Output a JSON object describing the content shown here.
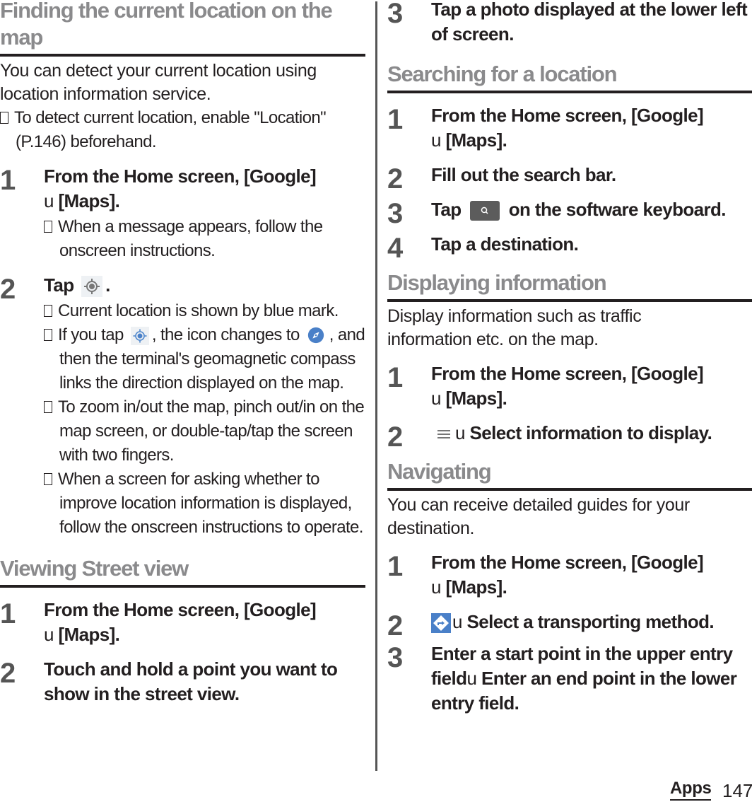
{
  "left_column": {
    "section1": {
      "title": "Finding the current location on the map",
      "intro": "You can detect your current location using location information service.",
      "notes": [
        "To detect current location, enable \"Location\" (P.146) beforehand."
      ],
      "steps": [
        {
          "number": "1",
          "text_a": "From the Home screen, [Google]",
          "arrow": "u",
          "text_b": "[Maps].",
          "notes": [
            "When a message appears, follow the onscreen instructions."
          ]
        },
        {
          "number": "2",
          "text_a": "Tap",
          "icon": "my-location-icon",
          "text_b": ".",
          "notes": [
            "Current location is shown by blue mark.",
            "If you tap",
            ", the icon changes to",
            ", and then the terminal's geomagnetic compass links the direction displayed on the map.",
            "To zoom in/out the map, pinch out/in on the map screen, or double-tap/tap the screen with two fingers.",
            "When a screen for asking whether to improve location information is displayed, follow the onscreen instructions to operate."
          ]
        }
      ]
    },
    "section2": {
      "title": "Viewing Street view",
      "steps": [
        {
          "number": "1",
          "text_a": "From the Home screen, [Google]",
          "arrow": "u",
          "text_b": "[Maps]."
        },
        {
          "number": "2",
          "text": "Touch and hold a point you want to show in the street view."
        }
      ]
    }
  },
  "right_column": {
    "section2_continued": {
      "steps": [
        {
          "number": "3",
          "text": "Tap a photo displayed at the lower left of screen."
        }
      ]
    },
    "section3": {
      "title": "Searching for a location",
      "steps": [
        {
          "number": "1",
          "text_a": "From the Home screen, [Google]",
          "arrow": "u",
          "text_b": "[Maps]."
        },
        {
          "number": "2",
          "text": "Fill out the search bar."
        },
        {
          "number": "3",
          "text_a": "Tap",
          "icon": "search-key-icon",
          "text_b": "on the software keyboard."
        },
        {
          "number": "4",
          "text": "Tap a destination."
        }
      ]
    },
    "section4": {
      "title": "Displaying information",
      "intro": "Display information such as traffic information etc. on the map.",
      "steps": [
        {
          "number": "1",
          "text_a": "From the Home screen, [Google]",
          "arrow": "u",
          "text_b": "[Maps]."
        },
        {
          "number": "2",
          "icon": "menu-icon",
          "arrow": "u",
          "text": "Select information to display."
        }
      ]
    },
    "section5": {
      "title": "Navigating",
      "intro": "You can receive detailed guides for your destination.",
      "steps": [
        {
          "number": "1",
          "text_a": "From the Home screen, [Google]",
          "arrow": "u",
          "text_b": "[Maps]."
        },
        {
          "number": "2",
          "icon": "directions-icon",
          "arrow": "u",
          "text": "Select a transporting method."
        },
        {
          "number": "3",
          "text_a": "Enter a start point in the upper entry field",
          "arrow": "u",
          "text_b": "Enter an end point in the lower entry field."
        }
      ]
    }
  },
  "footer": {
    "chapter": "Apps",
    "page_number": "147"
  },
  "colors": {
    "heading_gray": "#8a8a8c",
    "step_number_gray": "#555555",
    "body_text": "#231f20",
    "icon_blue": "#4a80c8",
    "search_key_gray": "#5c5c5c"
  }
}
